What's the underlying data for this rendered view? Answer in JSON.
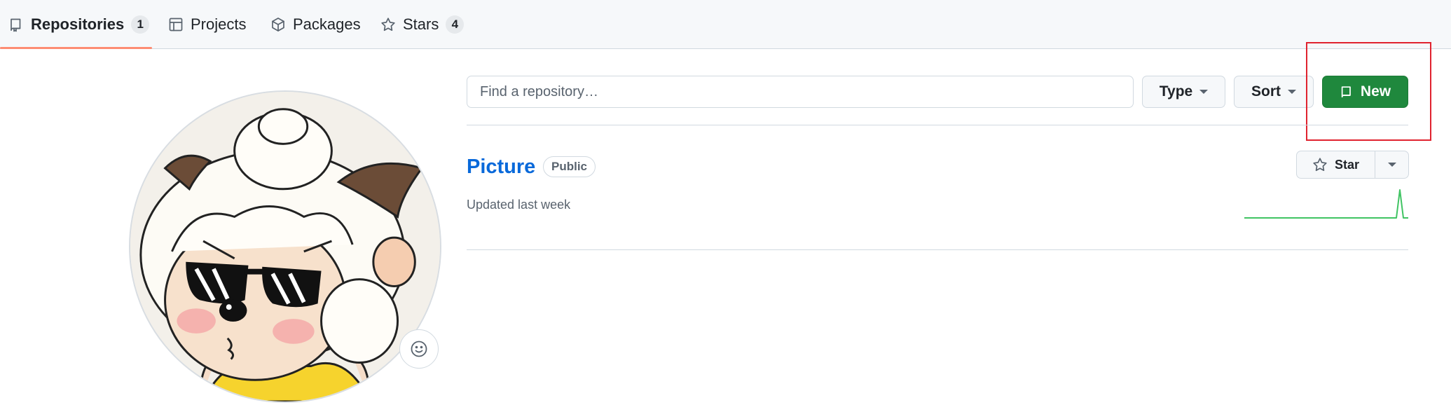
{
  "tabs": [
    {
      "label": "Repositories",
      "count": "1",
      "icon": "repo-icon",
      "selected": true
    },
    {
      "label": "Projects",
      "icon": "table-icon"
    },
    {
      "label": "Packages",
      "icon": "package-icon"
    },
    {
      "label": "Stars",
      "count": "4",
      "icon": "star-icon"
    }
  ],
  "filters": {
    "search_placeholder": "Find a repository…",
    "type_label": "Type",
    "sort_label": "Sort",
    "new_label": "New"
  },
  "repo": {
    "name": "Picture",
    "visibility": "Public",
    "updated": "Updated last week",
    "star_label": "Star"
  },
  "colors": {
    "accent_green": "#1f883d",
    "link_blue": "#0969da",
    "tab_underline": "#fd8c73",
    "highlight_red": "#e0232f",
    "sparkline": "#40c463"
  }
}
